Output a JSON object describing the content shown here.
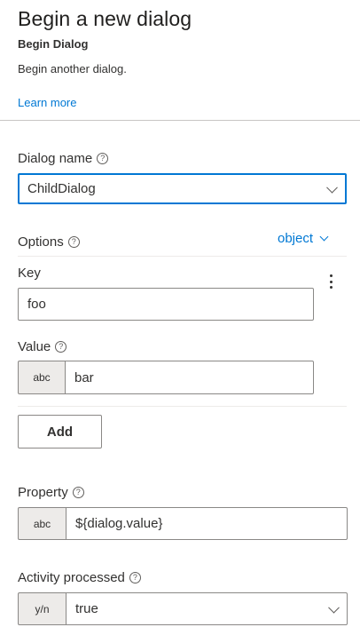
{
  "header": {
    "title": "Begin a new dialog",
    "subtitle": "Begin Dialog",
    "description": "Begin another dialog.",
    "learn_more": "Learn more"
  },
  "dialog_name": {
    "label": "Dialog name",
    "value": "ChildDialog"
  },
  "options": {
    "label": "Options",
    "type_selector": "object",
    "key_label": "Key",
    "key_value": "foo",
    "value_label": "Value",
    "value_type": "abc",
    "value_value": "bar",
    "add_button": "Add"
  },
  "property": {
    "label": "Property",
    "type": "abc",
    "value": "${dialog.value}"
  },
  "activity_processed": {
    "label": "Activity processed",
    "type": "y/n",
    "value": "true"
  },
  "colors": {
    "accent": "#0078d4",
    "border": "#8a8886",
    "type_box_bg": "#edebe9"
  },
  "icons": [
    "help-icon",
    "chevron-down-icon",
    "more-vertical-icon"
  ]
}
